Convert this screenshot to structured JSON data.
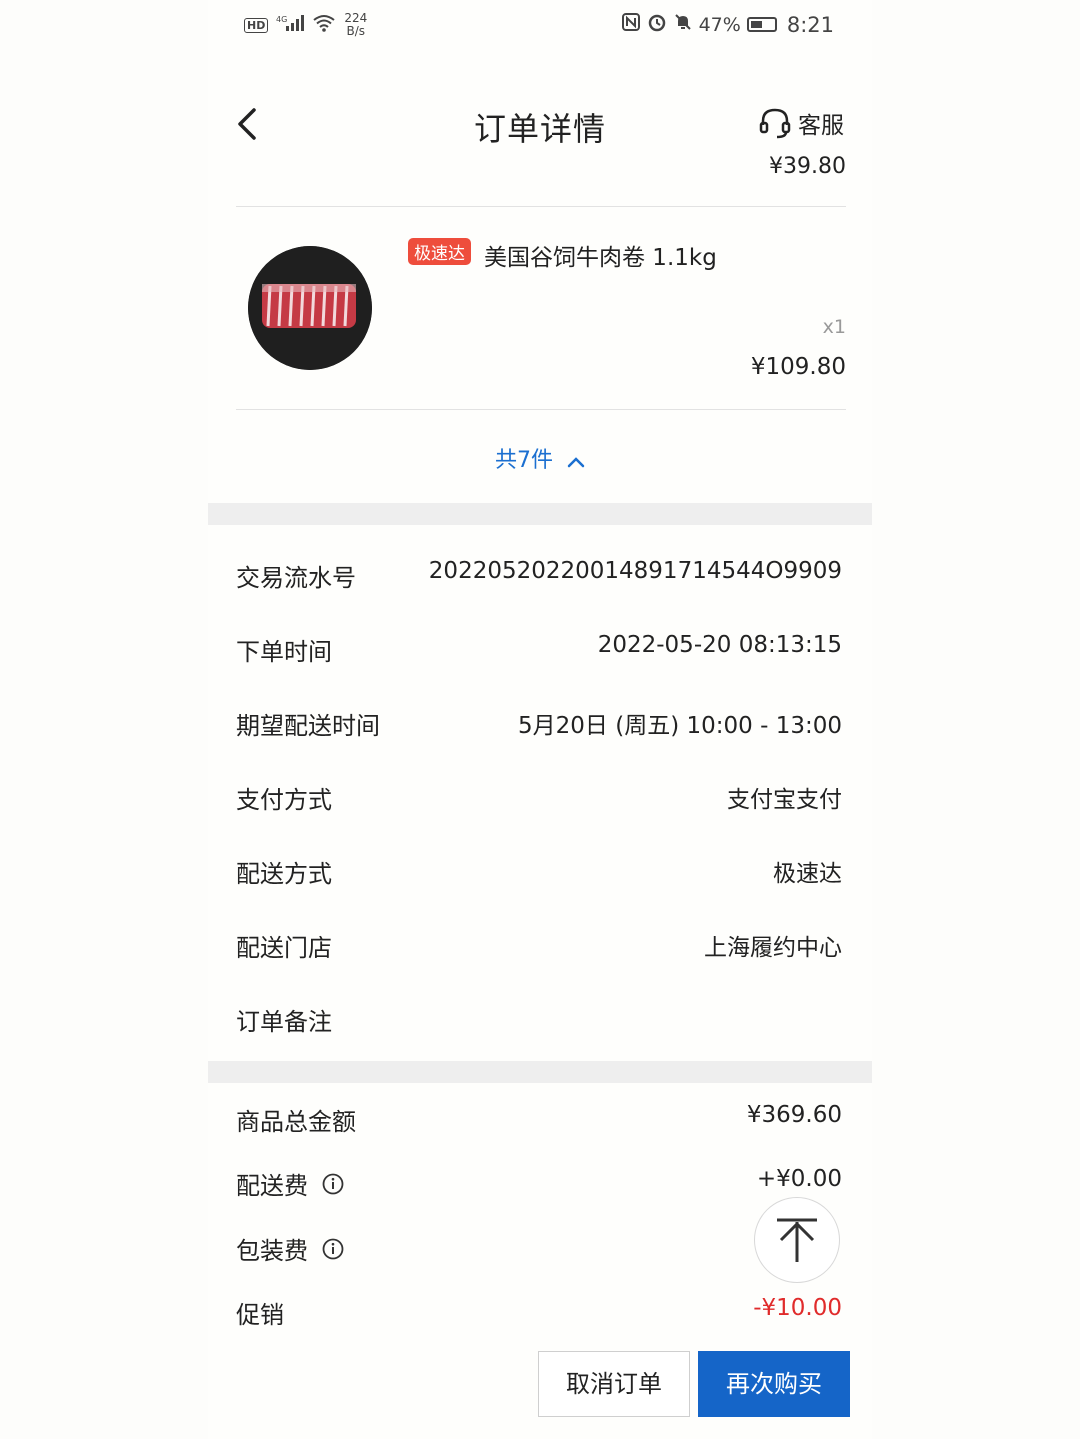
{
  "status_bar": {
    "hd": "HD",
    "network": "4G",
    "speed_value": "224",
    "speed_unit": "B/s",
    "battery": "47%",
    "time": "8:21"
  },
  "header": {
    "title": "订单详情",
    "service_label": "客服"
  },
  "previous_item_price": "¥39.80",
  "product": {
    "tag": "极速达",
    "name": "美国谷饲牛肉卷 1.1kg",
    "quantity": "x1",
    "price": "¥109.80"
  },
  "expand_label": "共7件",
  "order_info": [
    {
      "label": "交易流水号",
      "value": "20220520220014891714544O9909"
    },
    {
      "label": "下单时间",
      "value": "2022-05-20 08:13:15"
    },
    {
      "label": "期望配送时间",
      "value": "5月20日 (周五) 10:00 - 13:00"
    },
    {
      "label": "支付方式",
      "value": "支付宝支付"
    },
    {
      "label": "配送方式",
      "value": "极速达"
    },
    {
      "label": "配送门店",
      "value": "上海履约中心"
    },
    {
      "label": "订单备注",
      "value": ""
    }
  ],
  "fees": [
    {
      "label": "商品总金额",
      "value": "¥369.60"
    },
    {
      "label": "配送费",
      "value": "+¥0.00"
    },
    {
      "label": "包装费",
      "value": ""
    },
    {
      "label": "促销",
      "value": "-¥10.00"
    }
  ],
  "actions": {
    "cancel": "取消订单",
    "rebuy": "再次购买"
  },
  "colors": {
    "accent_blue": "#1565c8",
    "link_blue": "#1b6fd0",
    "tag_red": "#ee4d3c",
    "discount_red": "#e02b2b"
  }
}
